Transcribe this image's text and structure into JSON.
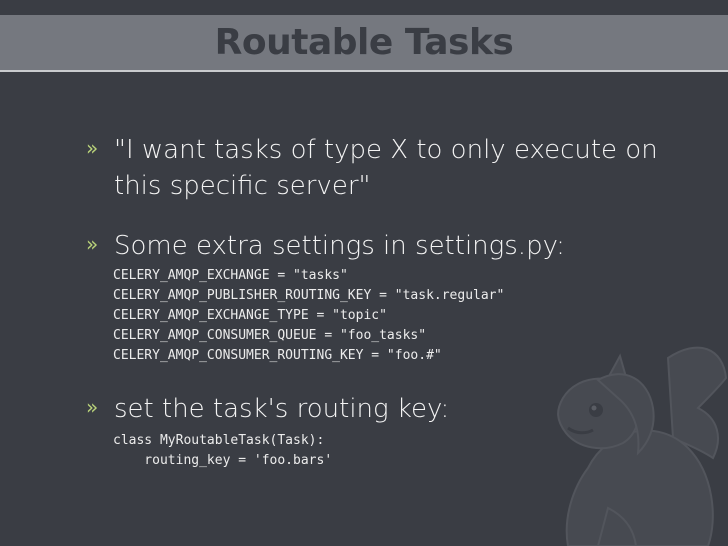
{
  "slide": {
    "title": "Routable Tasks",
    "bullet_marker": "»",
    "bullets": [
      {
        "text": "\"I want tasks of type X to only execute on this specific server\""
      },
      {
        "text": "Some extra settings in settings.py:"
      },
      {
        "text": "set the task's routing key:"
      }
    ],
    "settings_code": [
      "CELERY_AMQP_EXCHANGE = \"tasks\"",
      "CELERY_AMQP_PUBLISHER_ROUTING_KEY = \"task.regular\"",
      "CELERY_AMQP_EXCHANGE_TYPE = \"topic\"",
      "CELERY_AMQP_CONSUMER_QUEUE = \"foo_tasks\"",
      "CELERY_AMQP_CONSUMER_ROUTING_KEY = \"foo.#\""
    ],
    "task_code": [
      "class MyRoutableTask(Task):",
      "    routing_key = 'foo.bars'"
    ]
  },
  "colors": {
    "background": "#3a3d44",
    "title_band": "#75787f",
    "bullet_marker": "#b9d27a",
    "text": "#f4f4f4"
  },
  "icons": {
    "watermark": "celery-mascot-icon"
  }
}
